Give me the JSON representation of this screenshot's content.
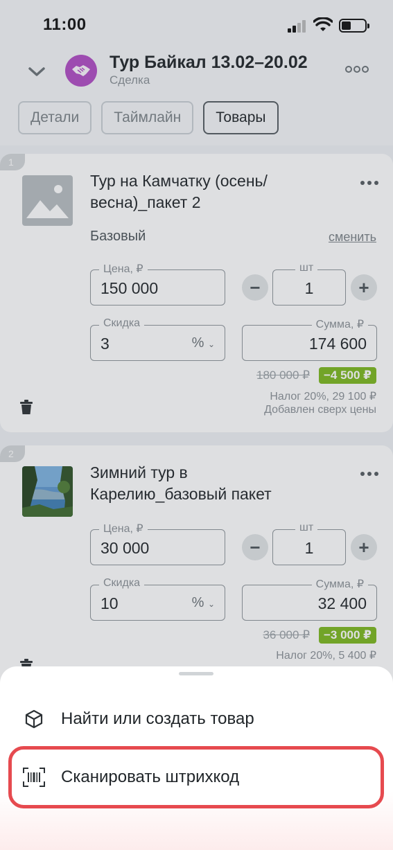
{
  "status_bar": {
    "time": "11:00"
  },
  "header": {
    "title": "Тур Байкал 13.02–20.02",
    "subtitle": "Сделка",
    "tabs": [
      {
        "label": "Детали",
        "active": false
      },
      {
        "label": "Таймлайн",
        "active": false
      },
      {
        "label": "Товары",
        "active": true
      }
    ],
    "avatar_color": "#b04cc4"
  },
  "products": [
    {
      "index": "1",
      "name": "Тур на Камчатку (осень/ весна)_пакет 2",
      "variant": "Базовый",
      "change_label": "сменить",
      "price_label": "Цена, ₽",
      "price": "150 000",
      "qty_label": "шт",
      "qty": "1",
      "discount_label": "Скидка",
      "discount": "3",
      "discount_unit": "%",
      "sum_label": "Сумма, ₽",
      "sum": "174 600",
      "old_price": "180 000 ₽",
      "discount_amount": "−4 500 ₽",
      "tax": "Налог 20%, 29 100 ₽",
      "tax_note": "Добавлен сверх цены",
      "image": "placeholder-image-icon"
    },
    {
      "index": "2",
      "name": "Зимний тур в Карелию_базовый пакет",
      "price_label": "Цена, ₽",
      "price": "30 000",
      "qty_label": "шт",
      "qty": "1",
      "discount_label": "Скидка",
      "discount": "10",
      "discount_unit": "%",
      "sum_label": "Сумма, ₽",
      "sum": "32 400",
      "old_price": "36 000 ₽",
      "discount_amount": "−3 000 ₽",
      "tax": "Налог 20%, 5 400 ₽",
      "image": "lake-photo"
    }
  ],
  "sheet": {
    "items": [
      {
        "label": "Найти или создать товар",
        "icon": "cube-icon"
      },
      {
        "label": "Сканировать штрихкод",
        "icon": "barcode-scan-icon",
        "highlighted": true
      }
    ]
  },
  "colors": {
    "accent_badge": "#7cb81e",
    "highlight_border": "#e64a4f"
  }
}
